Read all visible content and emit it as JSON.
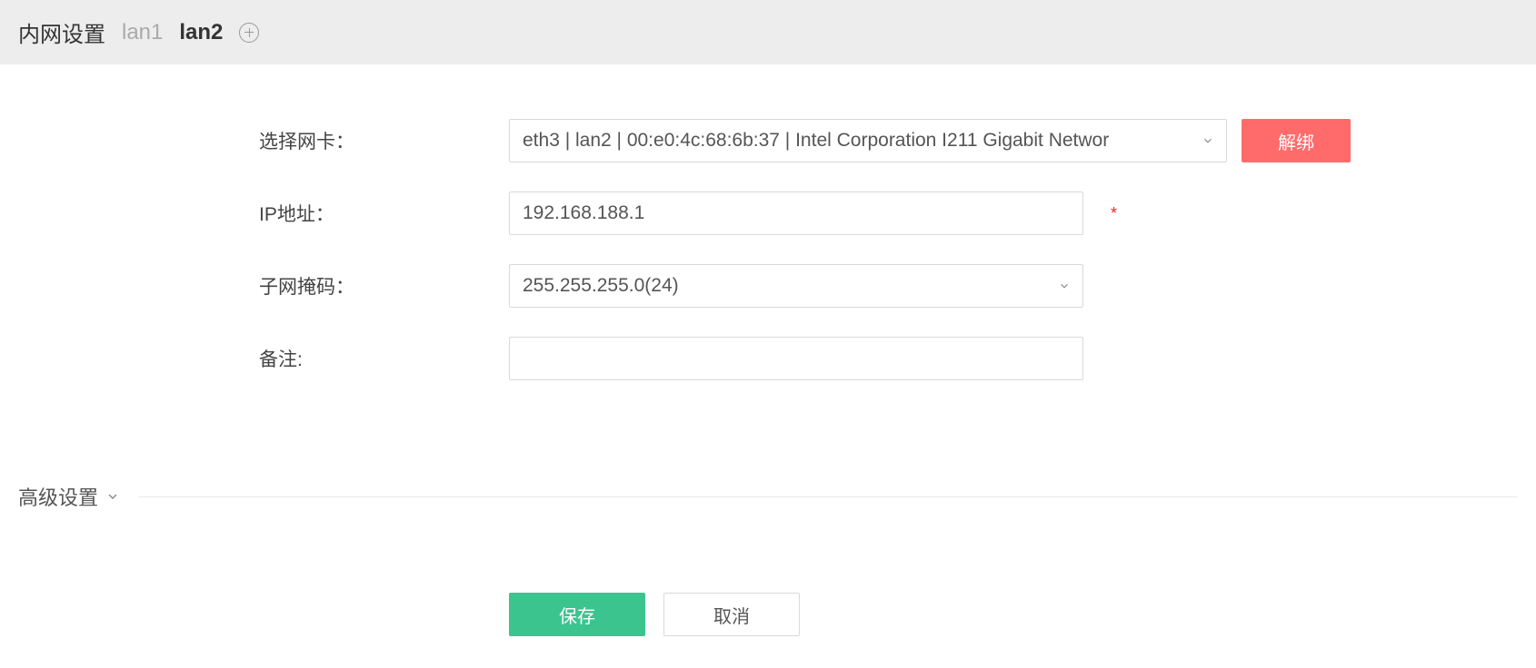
{
  "header": {
    "title": "内网设置",
    "tabs": [
      "lan1",
      "lan2"
    ],
    "active_tab_index": 1
  },
  "form": {
    "nic": {
      "label": "选择网卡：",
      "value": "eth3 | lan2 | 00:e0:4c:68:6b:37 | Intel Corporation I211 Gigabit Networ",
      "unbind_label": "解绑"
    },
    "ip": {
      "label": "IP地址：",
      "value": "192.168.188.1"
    },
    "mask": {
      "label": "子网掩码：",
      "value": "255.255.255.0(24)"
    },
    "remark": {
      "label": "备注:",
      "value": ""
    }
  },
  "advanced": {
    "label": "高级设置"
  },
  "buttons": {
    "save": "保存",
    "cancel": "取消"
  }
}
